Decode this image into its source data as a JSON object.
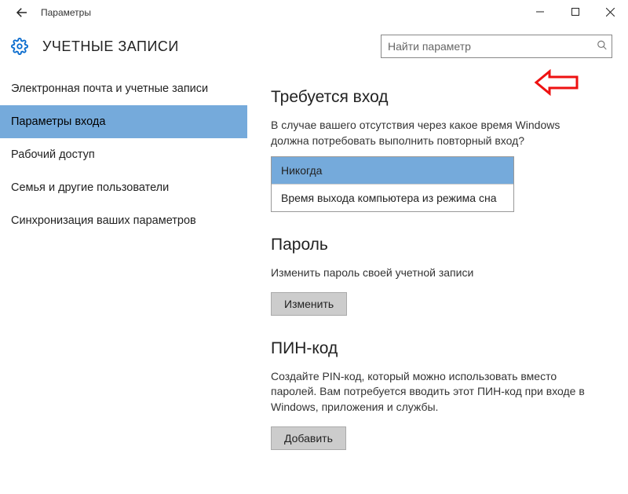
{
  "window": {
    "title": "Параметры"
  },
  "header": {
    "page_title": "УЧЕТНЫЕ ЗАПИСИ",
    "search_placeholder": "Найти параметр"
  },
  "sidebar": {
    "items": [
      {
        "label": "Электронная почта и учетные записи",
        "selected": false
      },
      {
        "label": "Параметры входа",
        "selected": true
      },
      {
        "label": "Рабочий доступ",
        "selected": false
      },
      {
        "label": "Семья и другие пользователи",
        "selected": false
      },
      {
        "label": "Синхронизация ваших параметров",
        "selected": false
      }
    ]
  },
  "content": {
    "signin_required": {
      "heading": "Требуется вход",
      "description": "В случае вашего отсутствия через какое время Windows должна потребовать выполнить повторный вход?",
      "options": [
        {
          "label": "Никогда",
          "selected": true
        },
        {
          "label": "Время выхода компьютера из режима сна",
          "selected": false
        }
      ]
    },
    "password": {
      "heading": "Пароль",
      "description": "Изменить пароль своей учетной записи",
      "button": "Изменить"
    },
    "pin": {
      "heading": "ПИН-код",
      "description": "Создайте PIN-код, который можно использовать вместо паролей. Вам потребуется вводить этот ПИН-код при входе в Windows, приложения и службы.",
      "button": "Добавить"
    }
  }
}
